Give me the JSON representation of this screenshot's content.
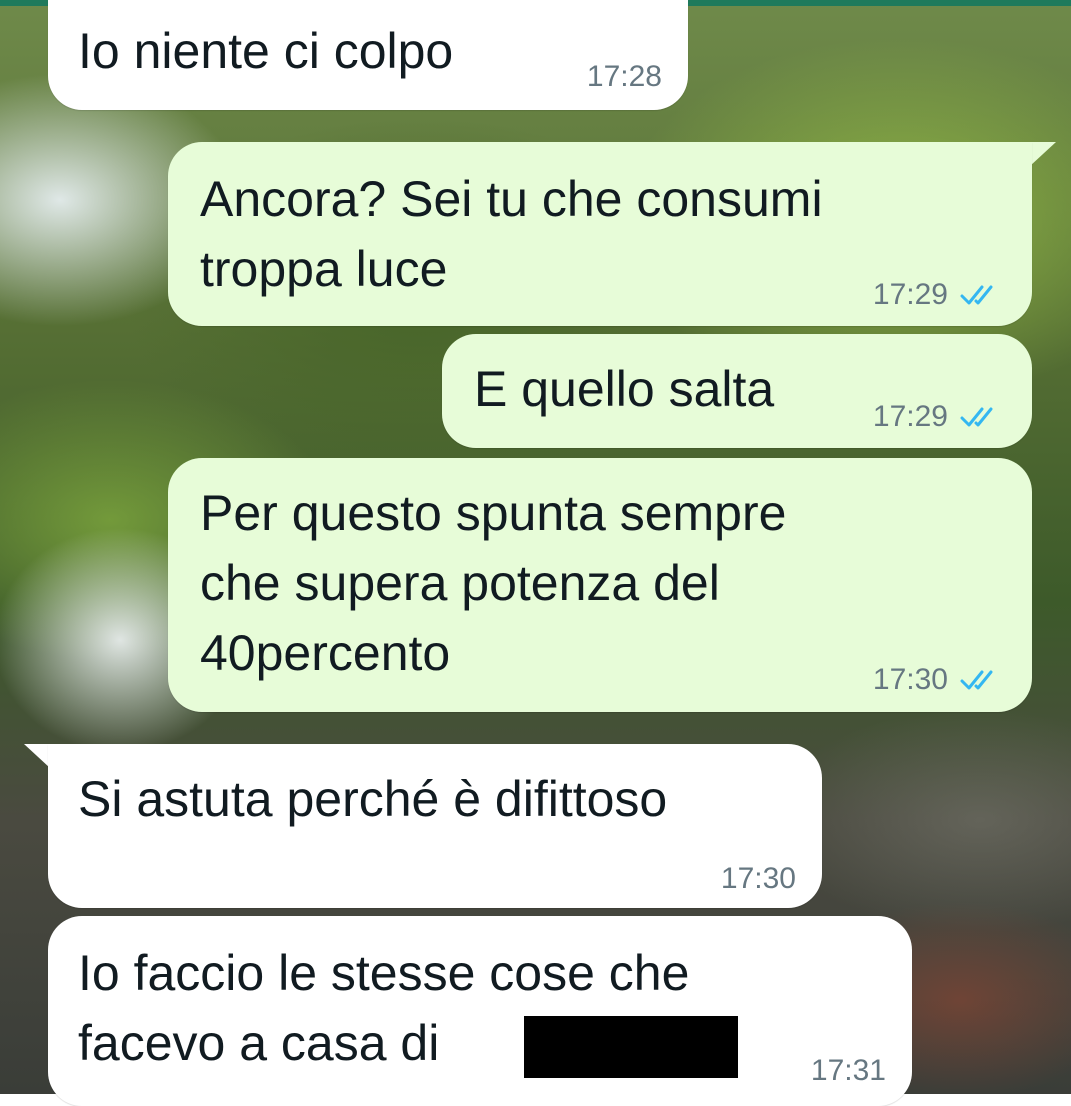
{
  "colors": {
    "incoming_bubble": "#ffffff",
    "outgoing_bubble": "#e7fcd8",
    "read_ticks": "#34b7f1",
    "timestamp": "#667781",
    "top_bar": "#1f7a5c"
  },
  "icons": {
    "read_receipt": "double-check-icon"
  },
  "messages": [
    {
      "direction": "incoming",
      "text": "Io niente ci colpo",
      "time": "17:28"
    },
    {
      "direction": "outgoing",
      "text": "Ancora? Sei tu che consumi\ntroppa luce",
      "time": "17:29",
      "status": "read"
    },
    {
      "direction": "outgoing",
      "text": "E quello salta",
      "time": "17:29",
      "status": "read"
    },
    {
      "direction": "outgoing",
      "text": "Per questo spunta sempre\nche supera potenza del\n40percento",
      "time": "17:30",
      "status": "read"
    },
    {
      "direction": "incoming",
      "text": "Si astuta perché è difittoso",
      "time": "17:30"
    },
    {
      "direction": "incoming",
      "text": "Io faccio le stesse cose che\nfacevo a casa di",
      "time": "17:31",
      "redacted": true
    }
  ]
}
